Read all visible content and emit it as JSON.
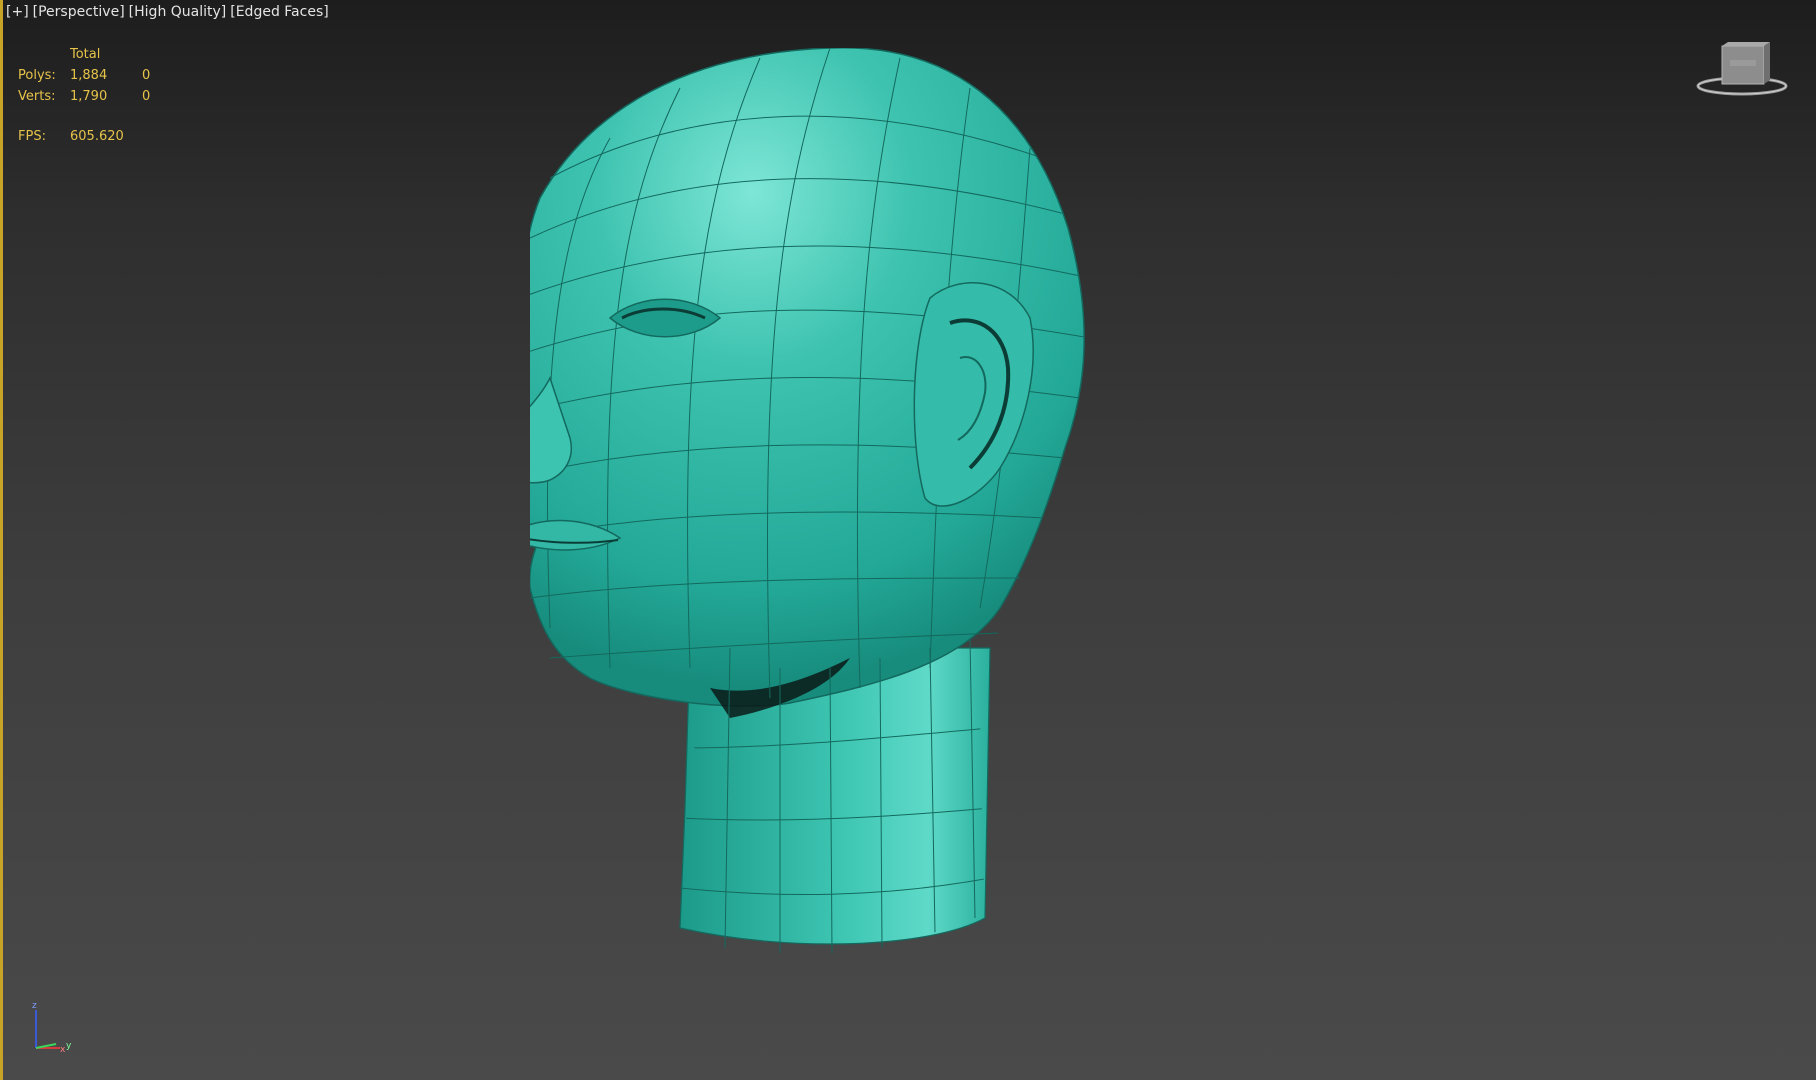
{
  "viewport": {
    "label_plus": "[+]",
    "label_view": "[Perspective]",
    "label_quality": "[High Quality]",
    "label_shading": "[Edged Faces]"
  },
  "stats": {
    "header_total": "Total",
    "polys_label": "Polys:",
    "polys_total": "1,884",
    "polys_selected": "0",
    "verts_label": "Verts:",
    "verts_total": "1,790",
    "verts_selected": "0",
    "fps_label": "FPS:",
    "fps_value": "605.620"
  },
  "axis_tripod": {
    "z_label": "z",
    "x_label": "x",
    "y_label": "y"
  },
  "colors": {
    "mesh_fill": "#2fb8a6",
    "mesh_edges": "#13695e",
    "stats_text": "#e6c34a",
    "viewport_border": "#c8a326"
  },
  "icons": {
    "viewcube": "viewcube-icon",
    "axis": "axis-tripod-icon"
  }
}
